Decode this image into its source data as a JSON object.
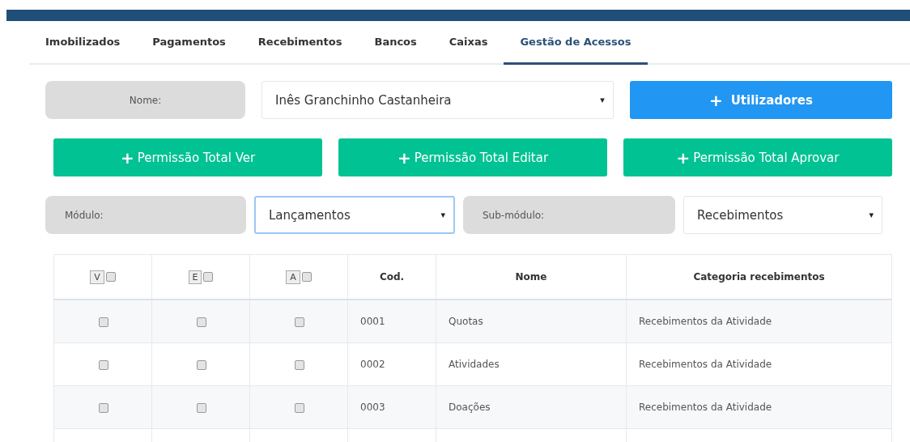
{
  "tabs": [
    {
      "label": "Imobilizados",
      "selected": false
    },
    {
      "label": "Pagamentos",
      "selected": false
    },
    {
      "label": "Recebimentos",
      "selected": false
    },
    {
      "label": "Bancos",
      "selected": false
    },
    {
      "label": "Caixas",
      "selected": false
    },
    {
      "label": "Gestão de Acessos",
      "selected": true
    }
  ],
  "name_label": "Nome:",
  "name_select": {
    "value": "Inês Granchinho Castanheira",
    "arrow": "▾"
  },
  "users_button": {
    "icon": "+",
    "label": "Utilizadores"
  },
  "permission_buttons": [
    {
      "icon": "+",
      "label": "Permissão Total Ver"
    },
    {
      "icon": "+",
      "label": "Permissão Total Editar"
    },
    {
      "icon": "+",
      "label": "Permissão Total Aprovar"
    }
  ],
  "module_label": "Módulo:",
  "module_select": {
    "value": "Lançamentos",
    "arrow": "▾",
    "focused": true
  },
  "submodule_label": "Sub-módulo:",
  "submodule_select": {
    "value": "Recebimentos",
    "arrow": "▾",
    "focused": false
  },
  "table": {
    "check_columns": [
      {
        "letter": "V",
        "checked": false
      },
      {
        "letter": "E",
        "checked": false
      },
      {
        "letter": "A",
        "checked": false
      }
    ],
    "columns": [
      "Cod.",
      "Nome",
      "Categoria recebimentos"
    ],
    "rows": [
      {
        "v": false,
        "e": false,
        "a": false,
        "cod": "0001",
        "nome": "Quotas",
        "categoria": "Recebimentos da Atividade"
      },
      {
        "v": false,
        "e": false,
        "a": false,
        "cod": "0002",
        "nome": "Atividades",
        "categoria": "Recebimentos da Atividade"
      },
      {
        "v": false,
        "e": false,
        "a": false,
        "cod": "0003",
        "nome": "Doações",
        "categoria": "Recebimentos da Atividade"
      }
    ]
  }
}
